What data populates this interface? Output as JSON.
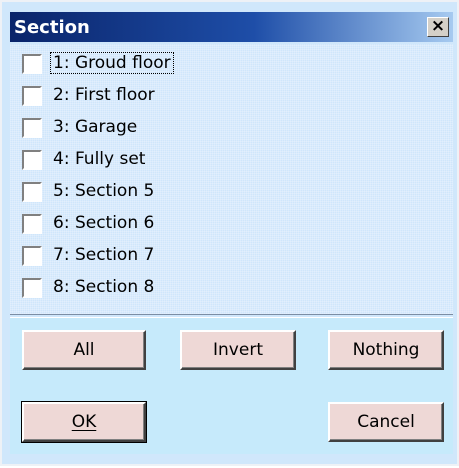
{
  "dialog": {
    "title": "Section",
    "close_glyph": "×"
  },
  "items": [
    {
      "label": "1: Groud floor",
      "checked": false
    },
    {
      "label": "2: First floor",
      "checked": false
    },
    {
      "label": "3: Garage",
      "checked": false
    },
    {
      "label": "4: Fully set",
      "checked": false
    },
    {
      "label": "5: Section 5",
      "checked": false
    },
    {
      "label": "6: Section 6",
      "checked": false
    },
    {
      "label": "7: Section 7",
      "checked": false
    },
    {
      "label": "8: Section 8",
      "checked": false
    }
  ],
  "buttons": {
    "all": "All",
    "invert": "Invert",
    "nothing": "Nothing",
    "ok": "OK",
    "cancel": "Cancel"
  },
  "colors": {
    "title_bar": "#0a246a",
    "list_background": "#cfe6fb",
    "button_area_background": "#c6eafb",
    "button_face": "#eed8d6"
  }
}
